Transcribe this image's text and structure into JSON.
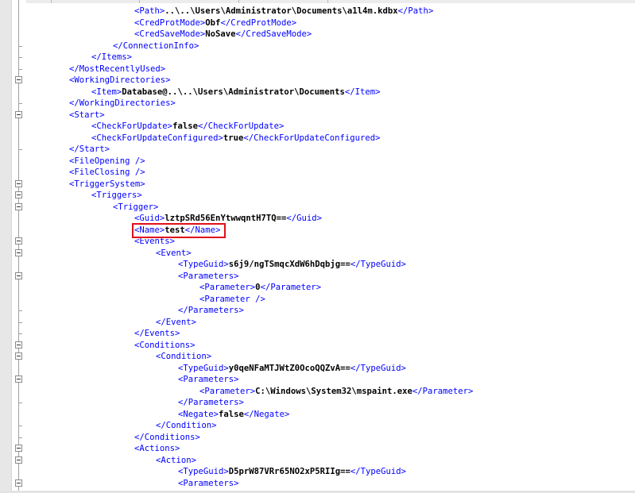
{
  "editor": {
    "lines": [
      {
        "parts": [
          {
            "t": "tag",
            "v": "<Path>"
          },
          {
            "t": "txt",
            "v": "..\\..\\Users\\Administrator\\Documents\\a1l4m.kdbx"
          },
          {
            "t": "tag",
            "v": "</Path>"
          }
        ]
      },
      {
        "parts": [
          {
            "t": "tag",
            "v": "<CredProtMode>"
          },
          {
            "t": "txt",
            "v": "Obf"
          },
          {
            "t": "tag",
            "v": "</CredProtMode>"
          }
        ]
      },
      {
        "parts": [
          {
            "t": "tag",
            "v": "<CredSaveMode>"
          },
          {
            "t": "txt",
            "v": "NoSave"
          },
          {
            "t": "tag",
            "v": "</CredSaveMode>"
          }
        ]
      },
      {
        "parts": [
          {
            "t": "tag",
            "v": "</ConnectionInfo>"
          }
        ]
      },
      {
        "parts": [
          {
            "t": "tag",
            "v": "</Items>"
          }
        ]
      },
      {
        "parts": [
          {
            "t": "tag",
            "v": "</MostRecentlyUsed>"
          }
        ]
      },
      {
        "parts": [
          {
            "t": "tag",
            "v": "<WorkingDirectories>"
          }
        ]
      },
      {
        "parts": [
          {
            "t": "tag",
            "v": "<Item>"
          },
          {
            "t": "txt",
            "v": "Database@..\\..\\Users\\Administrator\\Documents"
          },
          {
            "t": "tag",
            "v": "</Item>"
          }
        ]
      },
      {
        "parts": [
          {
            "t": "tag",
            "v": "</WorkingDirectories>"
          }
        ]
      },
      {
        "parts": [
          {
            "t": "tag",
            "v": "<Start>"
          }
        ]
      },
      {
        "parts": [
          {
            "t": "tag",
            "v": "<CheckForUpdate>"
          },
          {
            "t": "txt",
            "v": "false"
          },
          {
            "t": "tag",
            "v": "</CheckForUpdate>"
          }
        ]
      },
      {
        "parts": [
          {
            "t": "tag",
            "v": "<CheckForUpdateConfigured>"
          },
          {
            "t": "txt",
            "v": "true"
          },
          {
            "t": "tag",
            "v": "</CheckForUpdateConfigured>"
          }
        ]
      },
      {
        "parts": [
          {
            "t": "tag",
            "v": "</Start>"
          }
        ]
      },
      {
        "parts": [
          {
            "t": "tag",
            "v": "<FileOpening />"
          }
        ]
      },
      {
        "parts": [
          {
            "t": "tag",
            "v": "<FileClosing />"
          }
        ]
      },
      {
        "parts": [
          {
            "t": "tag",
            "v": "<TriggerSystem>"
          }
        ]
      },
      {
        "parts": [
          {
            "t": "tag",
            "v": "<Triggers>"
          }
        ]
      },
      {
        "parts": [
          {
            "t": "tag",
            "v": "<Trigger>"
          }
        ]
      },
      {
        "parts": [
          {
            "t": "tag",
            "v": "<Guid>"
          },
          {
            "t": "txt",
            "v": "lztpSRd56EnYtwwqntH7TQ=="
          },
          {
            "t": "tag",
            "v": "</Guid>"
          }
        ]
      },
      {
        "parts": [
          {
            "t": "tag",
            "v": "<Name>"
          },
          {
            "t": "txt",
            "v": "test"
          },
          {
            "t": "tag",
            "v": "</Name>"
          }
        ]
      },
      {
        "parts": [
          {
            "t": "tag",
            "v": "<Events>"
          }
        ]
      },
      {
        "parts": [
          {
            "t": "tag",
            "v": "<Event>"
          }
        ]
      },
      {
        "parts": [
          {
            "t": "tag",
            "v": "<TypeGuid>"
          },
          {
            "t": "txt",
            "v": "s6j9/ngTSmqcXdW6hDqbjg=="
          },
          {
            "t": "tag",
            "v": "</TypeGuid>"
          }
        ]
      },
      {
        "parts": [
          {
            "t": "tag",
            "v": "<Parameters>"
          }
        ]
      },
      {
        "parts": [
          {
            "t": "tag",
            "v": "<Parameter>"
          },
          {
            "t": "txt",
            "v": "0"
          },
          {
            "t": "tag",
            "v": "</Parameter>"
          }
        ]
      },
      {
        "parts": [
          {
            "t": "tag",
            "v": "<Parameter />"
          }
        ]
      },
      {
        "parts": [
          {
            "t": "tag",
            "v": "</Parameters>"
          }
        ]
      },
      {
        "parts": [
          {
            "t": "tag",
            "v": "</Event>"
          }
        ]
      },
      {
        "parts": [
          {
            "t": "tag",
            "v": "</Events>"
          }
        ]
      },
      {
        "parts": [
          {
            "t": "tag",
            "v": "<Conditions>"
          }
        ]
      },
      {
        "parts": [
          {
            "t": "tag",
            "v": "<Condition>"
          }
        ]
      },
      {
        "parts": [
          {
            "t": "tag",
            "v": "<TypeGuid>"
          },
          {
            "t": "txt",
            "v": "y0qeNFaMTJWtZ0OcoQQZvA=="
          },
          {
            "t": "tag",
            "v": "</TypeGuid>"
          }
        ]
      },
      {
        "parts": [
          {
            "t": "tag",
            "v": "<Parameters>"
          }
        ]
      },
      {
        "parts": [
          {
            "t": "tag",
            "v": "<Parameter>"
          },
          {
            "t": "txt",
            "v": "C:\\Windows\\System32\\mspaint.exe"
          },
          {
            "t": "tag",
            "v": "</Parameter>"
          }
        ]
      },
      {
        "parts": [
          {
            "t": "tag",
            "v": "</Parameters>"
          }
        ]
      },
      {
        "parts": [
          {
            "t": "tag",
            "v": "<Negate>"
          },
          {
            "t": "txt",
            "v": "false"
          },
          {
            "t": "tag",
            "v": "</Negate>"
          }
        ]
      },
      {
        "parts": [
          {
            "t": "tag",
            "v": "</Condition>"
          }
        ]
      },
      {
        "parts": [
          {
            "t": "tag",
            "v": "</Conditions>"
          }
        ]
      },
      {
        "parts": [
          {
            "t": "tag",
            "v": "<Actions>"
          }
        ]
      },
      {
        "parts": [
          {
            "t": "tag",
            "v": "<Action>"
          }
        ]
      },
      {
        "parts": [
          {
            "t": "tag",
            "v": "<TypeGuid>"
          },
          {
            "t": "txt",
            "v": "D5prW87VRr65NO2xP5RIIg=="
          },
          {
            "t": "tag",
            "v": "</TypeGuid>"
          }
        ]
      },
      {
        "parts": [
          {
            "t": "tag",
            "v": "<Parameters>"
          }
        ]
      }
    ]
  },
  "colors": {
    "tag": "#0000ff",
    "text": "#000000",
    "highlight": "#e0101a"
  }
}
